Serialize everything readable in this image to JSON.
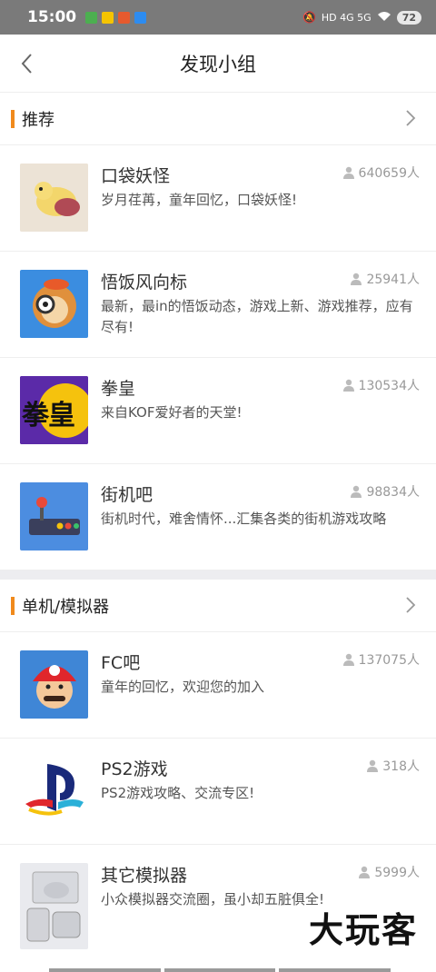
{
  "status_bar": {
    "time": "15:00",
    "network": "HD 4G 5G",
    "battery": "72",
    "app_colors": [
      "#4caf50",
      "#f5c400",
      "#e65a2e",
      "#2d8cf0"
    ]
  },
  "header": {
    "title": "发现小组",
    "back_icon": "chevron-left-icon"
  },
  "sections": [
    {
      "label": "推荐",
      "accent": "#f08a1c",
      "groups": [
        {
          "name": "口袋妖怪",
          "members": "640659人",
          "desc": "岁月荏苒，童年回忆，口袋妖怪!"
        },
        {
          "name": "悟饭风向标",
          "members": "25941人",
          "desc": "最新，最in的悟饭动态，游戏上新、游戏推荐，应有尽有!"
        },
        {
          "name": "拳皇",
          "members": "130534人",
          "desc": "来自KOF爱好者的天堂!",
          "thumb_text": "拳皇"
        },
        {
          "name": "街机吧",
          "members": "98834人",
          "desc": "街机时代，难舍情怀...汇集各类的街机游戏攻略"
        }
      ]
    },
    {
      "label": "单机/模拟器",
      "accent": "#f08a1c",
      "groups": [
        {
          "name": "FC吧",
          "members": "137075人",
          "desc": "童年的回忆，欢迎您的加入"
        },
        {
          "name": "PS2游戏",
          "members": "318人",
          "desc": "PS2游戏攻略、交流专区!"
        },
        {
          "name": "其它模拟器",
          "members": "5999人",
          "desc": "小众模拟器交流圈，虽小却五脏俱全!"
        }
      ]
    }
  ],
  "watermark": "大玩客"
}
